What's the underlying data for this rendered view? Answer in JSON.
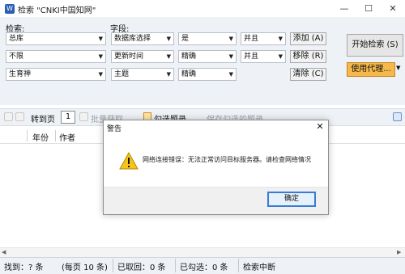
{
  "window": {
    "title": "检索 \"CNKI中国知网\"",
    "controls": {
      "minimize": "—",
      "maximize": "☐",
      "close": "✕"
    }
  },
  "search": {
    "search_label": "检索:",
    "field_label": "字段:",
    "rows": [
      {
        "scope": "总库",
        "field": "数据库选择",
        "match": "是",
        "logic": "并且"
      },
      {
        "scope": "不限",
        "field": "更新时间",
        "match": "精确",
        "logic": "并且"
      },
      {
        "scope": "生育神",
        "field": "主题",
        "match": "精确",
        "logic": ""
      }
    ],
    "add_btn": "添加 (A)",
    "remove_btn": "移除 (R)",
    "clear_btn": "清除 (C)",
    "start_btn": "开始检索 (S)",
    "proxy_btn": "使用代理..."
  },
  "toolbar": {
    "goto_label": "转到页",
    "page_value": "1",
    "batch_label": "批量获取",
    "checked_label": "勾选题录",
    "save_label": "保存勾选的题录"
  },
  "table": {
    "columns": [
      "年份",
      "作者"
    ]
  },
  "dialog": {
    "title": "警告",
    "message": "网络连接错误：无法正常访问目标服务器。请检查网络情况",
    "ok": "确定",
    "close": "✕"
  },
  "status": {
    "found": "找到：? 条",
    "per_page": "(每页 10 条)",
    "fetched": "已取回：0 条",
    "checked": "已勾选：0 条",
    "state": "检索中断"
  }
}
